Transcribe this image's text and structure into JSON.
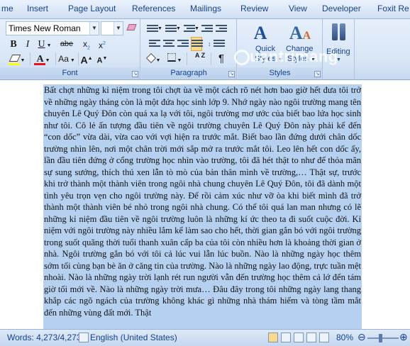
{
  "tabs": [
    "me",
    "Insert",
    "Page Layout",
    "References",
    "Mailings",
    "Review",
    "View",
    "Developer",
    "Foxit Re"
  ],
  "font_group": {
    "font_name": "Times New Roman",
    "font_size": "",
    "label": "Font",
    "bold": "B",
    "italic": "I",
    "underline": "U",
    "strikethrough": "abe",
    "subscript": "x",
    "superscript": "x",
    "font_color": "A",
    "change_case": "Aa",
    "grow": "A",
    "shrink": "A"
  },
  "paragraph_group": {
    "label": "Paragraph",
    "sort": "A Z",
    "show_marks": "¶"
  },
  "styles_group": {
    "label": "Styles",
    "quick_styles": "Quick\nStyles",
    "quick_styles_line1": "Quick",
    "quick_styles_line2": "Styles",
    "change_styles_line1": "Change",
    "change_styles_line2": "Styles"
  },
  "editing_group": {
    "label": "Editing"
  },
  "watermark": "uantrimang",
  "document_text": "Bất chợt những kỉ niệm trong tôi chợt ùa về một cách rõ nét hơn bao giờ hết đưa tôi trở về những ngày tháng còn là một đứa học sinh lớp 9. Nhớ ngày nào ngôi trường mang tên chuyên Lê Quý Đôn còn quá xa lạ với tôi, ngôi trường mơ ước của biết bao lứa học sinh như tôi. Cô lẻ ấn tượng đầu tiên về ngôi trường chuyên Lê Quý Đôn này phải kể đến “con dốc” vừa dài, vừa cao với vợi hiện ra trước mắt. Biết bao lần đứng dưới chân dốc trường nhìn lên, nơi một chân trời mới sắp mở ra trước mắt tôi. Leo lên hết con dốc ấy, lần đầu tiên đứng ở cổng trường học nhìn vào trường, tôi đã hét thật to như để thỏa mãn sự sung sướng, thích thú xen lẫn tò mò của bản thân mình về trường,… Thật sự, trước khi trở thành một thành viên trong ngôi nhà chung chuyên Lê Quý Đôn, tôi đã dành một tình yêu trọn vẹn cho ngôi trường này. Để rồi cảm xúc như vỡ òa khi biết mình đã trở thành một thành viên bé nhỏ trong ngôi nhà chung. Có thể tôi quá lan man nhưng có lẽ những kỉ niệm đầu tiên về ngôi trường luôn là những kí ức theo ta đi suốt cuộc đời. Kỉ niệm với ngôi trường này nhiều lắm kể làm sao cho hết, thời gian gắn bó với ngôi trường trong suốt quãng thời tuổi thanh xuân cấp ba của tôi còn nhiều hơn là khoảng thời gian ở nhà. Ngôi trường gắn bó với tôi cả lúc vui lẫn lúc buồn. Nào là những ngày học thêm sớm tối cùng bạn bè ăn ở căng tin của trường. Nào là những ngày lao động, trực tuần mệt nhoài. Nào là những ngày trời lạnh rét run người vẫn đến trường học thêm cả lớ đến tám giờ tối mới về. Nào là những ngày trời mưa… Đâu đây trong tôi những ngày lang thang khắp các ngõ ngách của trường không khác gì những nhà thám hiểm và tòng tầm mắt đến những vùng đất mới. Thật",
  "status": {
    "words": "Words: 4,273/4,273",
    "language": "English (United States)",
    "zoom": "80%"
  }
}
